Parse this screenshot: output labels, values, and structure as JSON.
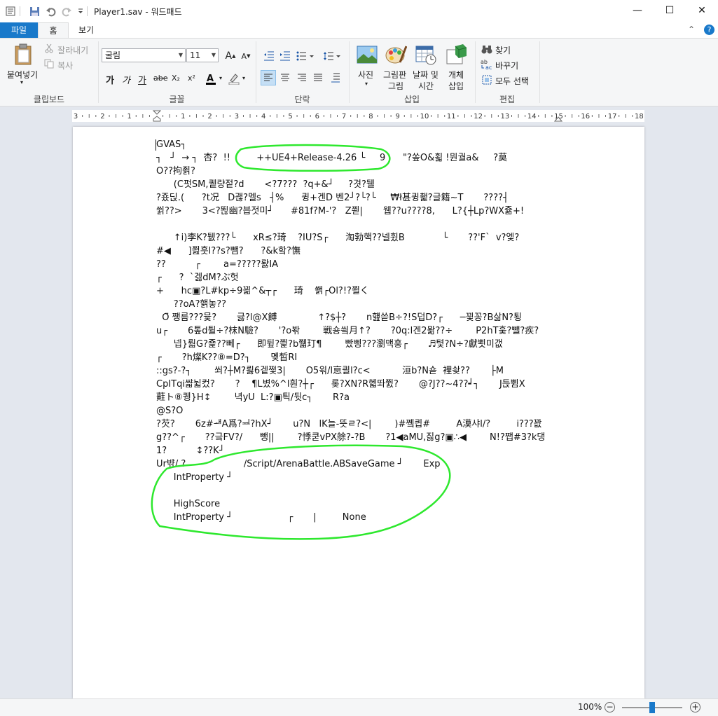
{
  "window": {
    "title": "Player1.sav - 워드패드",
    "minimize": "—",
    "maximize": "☐",
    "close": "✕"
  },
  "tabs": [
    {
      "label": "파일"
    },
    {
      "label": "홈"
    },
    {
      "label": "보기"
    }
  ],
  "clipboard": {
    "paste": "붙여넣기",
    "cut": "잘라내기",
    "copy": "복사",
    "group": "클립보드"
  },
  "font": {
    "name": "굴림",
    "size": "11",
    "bold": "가",
    "italic": "가",
    "underline": "가",
    "strike": "abe",
    "subscript": "X₂",
    "superscript": "x²",
    "group": "글꼴"
  },
  "paragraph": {
    "group": "단락"
  },
  "insert": {
    "picture": "사진",
    "paint_line1": "그림판",
    "paint_line2": "그림",
    "datetime_line1": "날짜 및",
    "datetime_line2": "시간",
    "object_line1": "개체",
    "object_line2": "삽입",
    "group": "삽입"
  },
  "editing": {
    "find": "찾기",
    "replace": "바꾸기",
    "select_all": "모두 선택",
    "group": "편집"
  },
  "ruler": {
    "labels": [
      "3",
      "2",
      "1",
      "1",
      "2",
      "3",
      "4",
      "5",
      "6",
      "7",
      "8",
      "9",
      "10",
      "11",
      "12",
      "13",
      "14",
      "15",
      "16",
      "17",
      "18"
    ]
  },
  "document": {
    "lines": [
      "GVAS┐",
      "┐   ┘  → ┐  杏?  !!         ++UE4+Release-4.26 └     9      \"?쏲O&횗 !뭔궐a&     ?莫",
      "O??拘죍?",
      "      (C펏SM,퀱량젙?d       <?7???  ?q+&┘     ?겻?퉬",
      "?죴딙.(      ?t况   D괞?멜s   ┤%      큉+겐D 벤2┘?└?└     ₩ł甚큉쵍?글籍~T       ????┤",
      "쓁??>       3<?뙪幽?븝젓미┘      #81f?M-'?   Z쯷|       웹??u????8,      L?{┼Lp?WX쥶+!",
      "",
      "      ↑i)李K?퉰???└      xR≤?琦    ?IU?S┌      淘勃핵??넬휬B             └       ??'F`  v?엧?",
      "#◀      ]쬞훗l??s?뺌?      ?&k핰?憮",
      "??          ┌        a=?????뢇IA",
      "┌      ?  `겛dM?ぶ헛",
      "+      hc▣?L#kp÷9꾊^&┬┌      琦    쐙┌Ol?!?쬘く",
      "      ??oA?핽놓??",
      "  Ο̈ 쨍름???뮻?       긇?l@X餺              ↑?$┼?       n햺쓷B÷?!S덥D?┌      ─꾗꽁?B삶N?툉",
      "u┌       6톺d튈÷?枺N驗?       '?o봒        戦숑씤月↑?       ?0q:l겐2뫎??÷        P2hT훛?뺄?疾?",
      "      넵}뤏G?죭??뻬┌      即뒾?쯽?b쮋玎¶        빴삥???瀏맥훙┌       ♬텿?N÷?獻뾧미갮",
      "┌       ?h燦K??⑧=D?┐       몢晳RI",
      "::gs?-?┐        쐬?┼M?뢿6겥쩣3|       O5왺/l恴킐l?c<           洹b?N숃  裡솾??       ├M",
      "CpITqi쌻뉣컸?       ?    ¶L볐%^l훤?┼┌      롲?XN?R헯똬쮨?       @?J??~4??┙┐       J듡쀰X",
      "蘣ト⑧퀭}H↕        녁yU  L:?▣틕/뒷c┐       R?a",
      "@S?O",
      "?芡?       6z#ᅫA爲?ᆋ?hX┘       u?N   lK늘-뜻ㄹ?<|        )#쪸킙#         A漠샤l/?         i???꽚",
      "g??^┌       ??긐FV?/      뺑||        ?悸쿧vPX艅?-?B       ?1◀aMU,짏g?▣∴◀        N!?쨉#3?k댕",
      "1?          ↕??K┘",
      "Ur뱎/ ?                    /Script/ArenaBattle.ABSaveGame ┘       Exp",
      "      IntProperty ┘",
      "",
      "      HighScore",
      "      IntProperty ┘                   ┌       |         None"
    ]
  },
  "status": {
    "zoom": "100%",
    "zoom_out": "−",
    "zoom_in": "+",
    "zoom_level_fraction": 0.5
  },
  "colors": {
    "file_tab": "#1979ca",
    "annotation": "#2ee82e",
    "workspace": "#e3e7ee",
    "ribbon": "#f5f6f7"
  }
}
